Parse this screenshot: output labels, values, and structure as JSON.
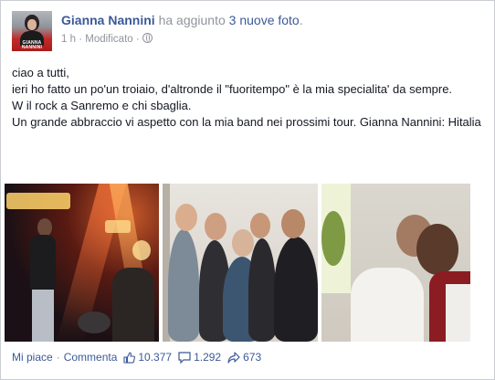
{
  "post": {
    "author": "Gianna Nannini",
    "action_text": "ha aggiunto",
    "photos_link": "3 nuove foto",
    "period": ".",
    "time": "1 h",
    "separator": "·",
    "modified": "Modificato",
    "avatar_brand": "GIANNA NANNINI",
    "lines": [
      "ciao a tutti,",
      "ieri ho fatto un po'un troiaio, d'altronde il \"fuoritempo\" è la mia specialita' da sempre.",
      "W il rock a Sanremo e chi sbaglia.",
      "Un grande abbraccio vi aspetto con la mia band nei prossimi tour. Gianna Nannini: Hitalia"
    ]
  },
  "footer": {
    "like_label": "Mi piace",
    "dot": "·",
    "comment_label": "Commenta",
    "likes_count": "10.377",
    "comments_count": "1.292",
    "shares_count": "673"
  },
  "colors": {
    "link": "#3b5998",
    "meta": "#90949c",
    "text": "#141823"
  },
  "icons": {
    "privacy": "globe-icon",
    "likes": "thumbs-up-icon",
    "comments": "comment-bubble-icon",
    "shares": "share-arrow-icon"
  }
}
